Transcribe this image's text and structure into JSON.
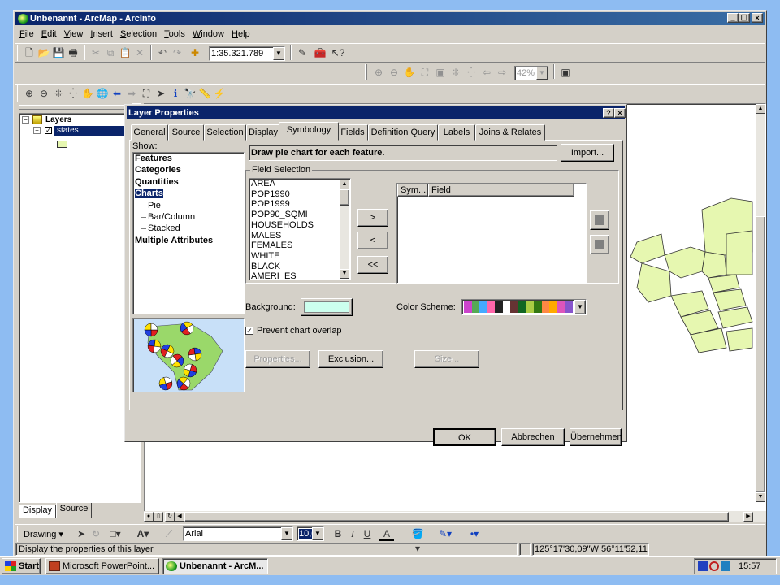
{
  "window": {
    "title": "Unbenannt - ArcMap - ArcInfo"
  },
  "menu": [
    {
      "u": "F",
      "rest": "ile"
    },
    {
      "u": "E",
      "rest": "dit"
    },
    {
      "u": "V",
      "rest": "iew"
    },
    {
      "u": "I",
      "rest": "nsert"
    },
    {
      "u": "S",
      "rest": "election"
    },
    {
      "u": "T",
      "rest": "ools"
    },
    {
      "u": "W",
      "rest": "indow"
    },
    {
      "u": "H",
      "rest": "elp"
    }
  ],
  "toolbar": {
    "scale": "1:35.321.789",
    "zoom_percent": "42%"
  },
  "toc": {
    "layers_label": "Layers",
    "layer_name": "states",
    "tab_display": "Display",
    "tab_source": "Source"
  },
  "dialog": {
    "title": "Layer Properties",
    "tabs": [
      "General",
      "Source",
      "Selection",
      "Display",
      "Symbology",
      "Fields",
      "Definition Query",
      "Labels",
      "Joins & Relates"
    ],
    "active_tab": "Symbology",
    "show_label": "Show:",
    "show_tree": [
      {
        "label": "Features",
        "level": 0,
        "bold": true
      },
      {
        "label": "Categories",
        "level": 0,
        "bold": true
      },
      {
        "label": "Quantities",
        "level": 0,
        "bold": true
      },
      {
        "label": "Charts",
        "level": 0,
        "bold": true,
        "selected": true
      },
      {
        "label": "Pie",
        "level": 1
      },
      {
        "label": "Bar/Column",
        "level": 1
      },
      {
        "label": "Stacked",
        "level": 1
      },
      {
        "label": "Multiple Attributes",
        "level": 0,
        "bold": true
      }
    ],
    "description": "Draw pie chart for each feature.",
    "import_button": "Import...",
    "field_selection_label": "Field Selection",
    "fields": [
      "AREA",
      "POP1990",
      "POP1999",
      "POP90_SQMI",
      "HOUSEHOLDS",
      "MALES",
      "FEMALES",
      "WHITE",
      "BLACK",
      "AMERI_ES"
    ],
    "add_button": ">",
    "remove_button": "<",
    "remove_all_button": "<<",
    "selected_columns": [
      "Sym...",
      "Field"
    ],
    "background_label": "Background:",
    "background_color": "#ccffee",
    "color_scheme_label": "Color Scheme:",
    "color_scheme": [
      "#cc44cc",
      "#55aa55",
      "#44aaff",
      "#ff66aa",
      "#222222",
      "#ffffff",
      "#663333",
      "#116622",
      "#aacc44",
      "#337711",
      "#ff8844",
      "#ffaa00",
      "#dd55bb",
      "#8855cc"
    ],
    "prevent_overlap_label": "Prevent chart overlap",
    "prevent_overlap_checked": true,
    "properties_button": "Properties...",
    "exclusion_button": "Exclusion...",
    "size_button": "Size...",
    "ok_button": "OK",
    "cancel_button": "Abbrechen",
    "apply_button": "Übernehmen"
  },
  "drawing": {
    "label": "Drawing",
    "font": "Arial",
    "size": "10,0"
  },
  "status": {
    "text": "Display the properties of this layer",
    "coords": "125°17'30,09\"W  56°11'52,11\"N"
  },
  "taskbar": {
    "start": "Start",
    "tasks": [
      "Microsoft PowerPoint...",
      "Unbenannt - ArcM..."
    ],
    "clock": "15:57"
  }
}
